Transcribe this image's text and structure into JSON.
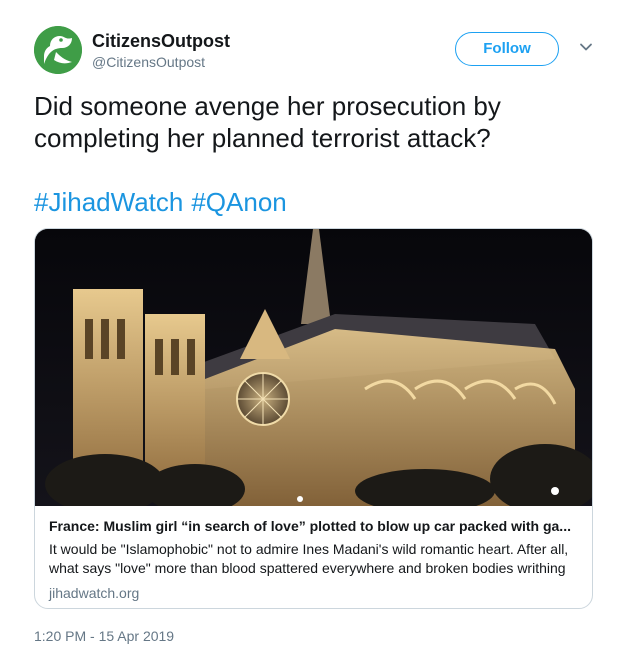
{
  "account": {
    "display_name": "CitizensOutpost",
    "handle": "@CitizensOutpost",
    "avatar_color": "#3f9d47"
  },
  "follow_button": {
    "label": "Follow",
    "color": "#1da1f2"
  },
  "menu": {
    "icon": "chevron-down-icon"
  },
  "tweet": {
    "text": "Did someone avenge her prosecution by completing her planned terrorist attack?",
    "hashtags": [
      "#JihadWatch",
      "#QAnon"
    ],
    "hashtag_color": "#1b95e0",
    "timestamp": "1:20 PM - 15 Apr 2019"
  },
  "card": {
    "title": "France: Muslim girl “in search of love” plotted to blow up car packed with ga...",
    "description": "It would be \"Islamophobic\" not to admire Ines Madani's wild romantic heart. After all, what says \"love\" more than blood spattered everywhere and broken bodies writhing",
    "domain": "jihadwatch.org"
  }
}
